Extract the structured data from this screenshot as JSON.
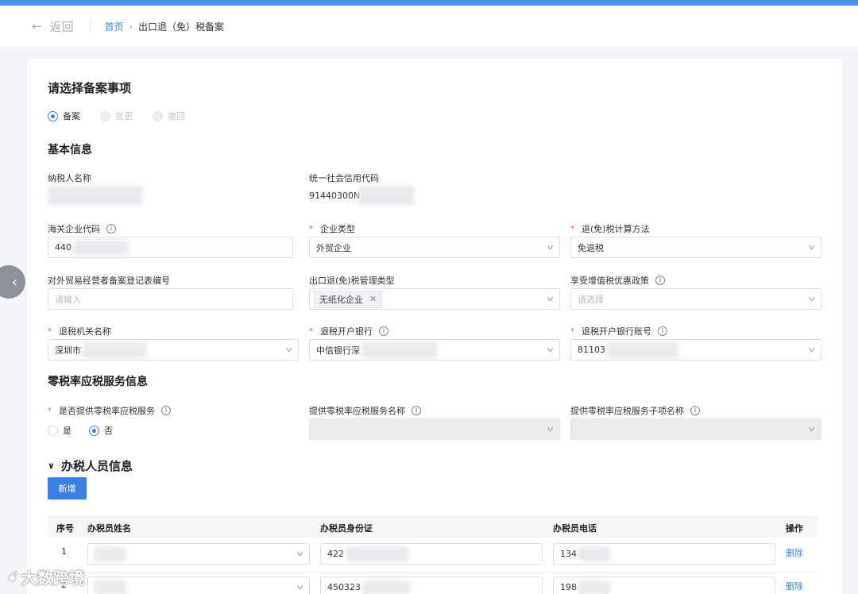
{
  "header": {
    "back_label": "返回",
    "breadcrumb_home": "首页",
    "breadcrumb_current": "出口退（免）税备案"
  },
  "section_select": {
    "title": "请选择备案事项",
    "options": [
      {
        "label": "备案",
        "selected": true,
        "disabled": false
      },
      {
        "label": "变更",
        "selected": false,
        "disabled": true
      },
      {
        "label": "撤回",
        "selected": false,
        "disabled": true
      }
    ]
  },
  "basic": {
    "title": "基本信息",
    "taxpayer_name_label": "纳税人名称",
    "credit_code_label": "统一社会信用代码",
    "credit_code_value": "91440300N",
    "customs_code_label": "海关企业代码",
    "customs_code_value": "440",
    "enterprise_type_label": "企业类型",
    "enterprise_type_value": "外贸企业",
    "calc_method_label": "退(免)税计算方法",
    "calc_method_value": "免退税",
    "trade_reg_label": "对外贸易经营者备案登记表编号",
    "trade_reg_placeholder": "请输入",
    "mgmt_type_label": "出口退(免)税管理类型",
    "mgmt_type_tag": "无纸化企业",
    "vat_policy_label": "享受增值税优惠政策",
    "vat_policy_placeholder": "请选择",
    "authority_label": "退税机关名称",
    "authority_value": "深圳市",
    "bank_label": "退税开户银行",
    "bank_value": "中信银行深",
    "account_label": "退税开户银行账号",
    "account_value": "81103"
  },
  "zero_rate": {
    "title": "零税率应税服务信息",
    "provide_label": "是否提供零税率应税服务",
    "options": [
      {
        "label": "是",
        "selected": false
      },
      {
        "label": "否",
        "selected": true
      }
    ],
    "service_name_label": "提供零税率应税服务名称",
    "sub_service_label": "提供零税率应税服务子项名称"
  },
  "staff": {
    "title": "办税人员信息",
    "add_button": "新增",
    "columns": [
      "序号",
      "办税员姓名",
      "办税员身份证",
      "办税员电话",
      "操作"
    ],
    "rows": [
      {
        "index": "1",
        "id_prefix": "422",
        "phone_prefix": "134",
        "action": "删除"
      },
      {
        "index": "2",
        "id_prefix": "450323",
        "phone_prefix": "198",
        "action": "删除"
      }
    ]
  },
  "watermark": "大数跨境"
}
